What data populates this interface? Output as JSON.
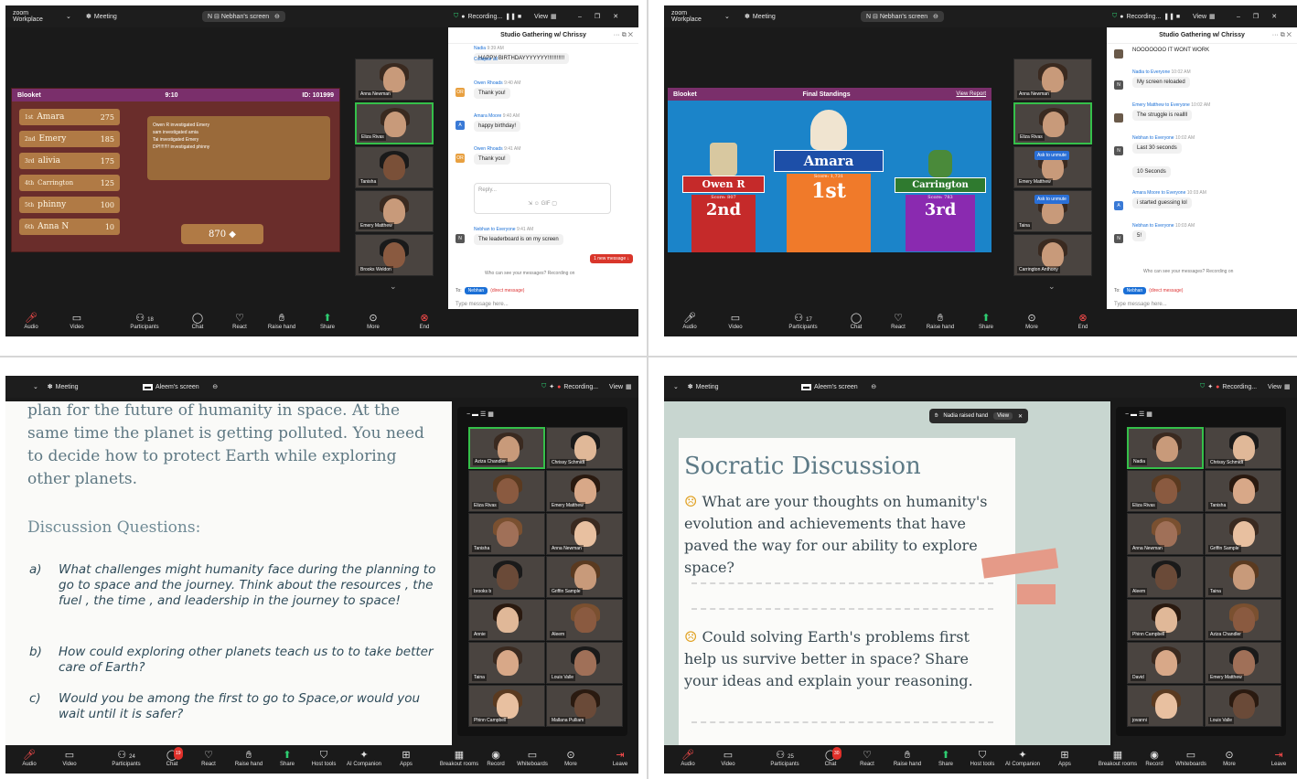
{
  "q1": {
    "app": "zoom Workplace",
    "meeting_label": "Meeting",
    "screen_label": "Nebhan's screen",
    "recording": "Recording...",
    "view": "View",
    "blooket": {
      "brand": "Blooket",
      "timer": "9:10",
      "id": "ID: 101999",
      "rows": [
        {
          "place": "1st",
          "name": "Amara",
          "pts": "275"
        },
        {
          "place": "2nd",
          "name": "Emery",
          "pts": "185"
        },
        {
          "place": "3rd",
          "name": "alivia",
          "pts": "175"
        },
        {
          "place": "4th",
          "name": "Carrington",
          "pts": "125"
        },
        {
          "place": "5th",
          "name": "phinny",
          "pts": "100"
        },
        {
          "place": "6th",
          "name": "Anna N",
          "pts": "10"
        }
      ],
      "feed": [
        "Owen R investigated Emery",
        "sam investigated amia",
        "Tai investigated Emery",
        "DP!!!!!!!! investigated phinny"
      ],
      "total": "870"
    },
    "tiles": [
      "Anna Newman",
      "Eliza Rivas",
      "Tanisha",
      "Emery Matthew",
      "Brooks Weldon"
    ],
    "chat": {
      "title": "Studio Gathering w/ Chrissy",
      "collapse": "Collapse all",
      "messages": [
        {
          "who": "Nadia",
          "time": "9:39 AM",
          "text": "HAPPY BIRTHDAYYYYYYY!!!!!!!!!!!"
        },
        {
          "who": "Owen Rhoads",
          "time": "9:40 AM",
          "text": "Thank you!"
        },
        {
          "who": "Amara Moore",
          "time": "9:40 AM",
          "text": "happy birthday!"
        },
        {
          "who": "Owen Rhoads",
          "time": "9:41 AM",
          "text": "Thank you!"
        },
        {
          "who": "Nebhan to Everyone",
          "time": "9:41 AM",
          "text": "The leaderboard is on my screen"
        }
      ],
      "reply": "Reply...",
      "new_message": "1 new message",
      "who_can_see": "Who can see your messages? Recording on",
      "to": "To:",
      "to_pill": "Nebhan",
      "direct": "(direct message)",
      "placeholder": "Type message here..."
    },
    "toolbar": [
      "Audio",
      "Video",
      "Participants",
      "Chat",
      "React",
      "Raise hand",
      "Share",
      "More",
      "End"
    ],
    "participants_count": "18"
  },
  "q2": {
    "app": "zoom Workplace",
    "meeting_label": "Meeting",
    "screen_label": "Nebhan's screen",
    "recording": "Recording...",
    "view": "View",
    "standings": {
      "brand": "Blooket",
      "title": "Final Standings",
      "view_report": "View Report",
      "first": {
        "name": "Amara",
        "score": "Score: 1,731",
        "place": "1st"
      },
      "second": {
        "name": "Owen R",
        "score": "Score: 807",
        "place": "2nd"
      },
      "third": {
        "name": "Carrington",
        "score": "Score: 783",
        "place": "3rd"
      }
    },
    "tiles": [
      "Anna Newman",
      "Eliza Rivas",
      "Emery Matthew",
      "Taina",
      "Carrington Anthony"
    ],
    "ask_unmute": "Ask to unmute",
    "chat": {
      "title": "Studio Gathering w/ Chrissy",
      "messages": [
        {
          "who": "",
          "time": "",
          "text": "NOOOOOOO IT WONT WORK"
        },
        {
          "who": "Nadia to Everyone",
          "time": "10:02 AM",
          "text": "My screen reloaded"
        },
        {
          "who": "Emery Matthew to Everyone",
          "time": "10:02 AM",
          "text": "The struggle is reallll"
        },
        {
          "who": "Nebhan to Everyone",
          "time": "10:02 AM",
          "text": "Last 30 seconds"
        },
        {
          "who": "",
          "time": "",
          "text": "10 Seconds"
        },
        {
          "who": "Amara Moore to Everyone",
          "time": "10:03 AM",
          "text": "i started guessing lol"
        },
        {
          "who": "Nebhan to Everyone",
          "time": "10:03 AM",
          "text": "5!"
        }
      ],
      "who_can_see": "Who can see your messages? Recording on",
      "to": "To:",
      "to_pill": "Nebhan",
      "direct": "(direct message)",
      "placeholder": "Type message here..."
    },
    "toolbar": [
      "Audio",
      "Video",
      "Participants",
      "Chat",
      "React",
      "Raise hand",
      "Share",
      "More",
      "End"
    ],
    "participants_count": "17"
  },
  "q3": {
    "meeting_label": "Meeting",
    "screen_label": "Aleem's screen",
    "recording": "Recording...",
    "view": "View",
    "slide_lines": [
      "plan for the future of humanity in space. At the",
      "same time the planet is getting polluted. You need",
      "to decide how to protect Earth while exploring",
      "other planets."
    ],
    "questions_head": "Discussion Questions:",
    "questions": [
      {
        "letter": "a)",
        "text": "What challenges might humanity face during the planning to go to space and the journey. Think about the resources , the fuel , the time , and leadership in the journey to space!"
      },
      {
        "letter": "b)",
        "text": "How could exploring other planets teach us to to take better care of Earth?"
      },
      {
        "letter": "c)",
        "text": "Would you be among the first to go to Space,or would you wait until it is safer?"
      }
    ],
    "tiles": [
      "Aziza Chandler",
      "Chrissy Schmidt",
      "Eliza Rivas",
      "Emery Matthew",
      "Tanisha",
      "Anna Newman",
      "brooks b",
      "Griffin Sample",
      "Annie",
      "Aleem",
      "Taina",
      "Louis Valle",
      "Phinn Campbell",
      "Mallana Pulliam"
    ],
    "toolbar": [
      "Audio",
      "Video",
      "Participants",
      "Chat",
      "React",
      "Raise hand",
      "Share",
      "Host tools",
      "AI Companion",
      "Apps",
      "Breakout rooms",
      "Record",
      "Whiteboards",
      "More",
      "Leave"
    ],
    "participants_count": "24",
    "chat_badge": "19"
  },
  "q4": {
    "meeting_label": "Meeting",
    "screen_label": "Aleem's screen",
    "recording": "Recording...",
    "view": "View",
    "raised_hand": "Nadia raised hand",
    "raised_view": "View",
    "slide_title": "Socratic Discussion",
    "q1": "What are your thoughts on humanity's evolution and achievements that have paved the way for our ability to explore space?",
    "q2": "Could solving Earth's problems first help us survive better in space? Share your ideas and explain your reasoning.",
    "nadia_tile": "Nadia",
    "tiles": [
      "Nadia",
      "Chrissy Schmidt",
      "Eliza Rivas",
      "Tanisha",
      "Anna Newman",
      "Griffin Sample",
      "Aleem",
      "Taina",
      "Phinn Campbell",
      "Aziza Chandler",
      "David",
      "Emery Matthew",
      "jovanni",
      "Louis Valle"
    ],
    "toolbar": [
      "Audio",
      "Video",
      "Participants",
      "Chat",
      "React",
      "Raise hand",
      "Share",
      "Host tools",
      "AI Companion",
      "Apps",
      "Breakout rooms",
      "Record",
      "Whiteboards",
      "More",
      "Leave"
    ],
    "participants_count": "25",
    "chat_badge": "30"
  }
}
